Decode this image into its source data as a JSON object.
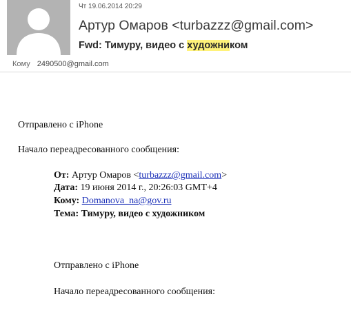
{
  "header": {
    "date": "Чт 19.06.2014 20:29",
    "from": "Артур Омаров <turbazzz@gmail.com>",
    "subject_parts": [
      "Fwd: Тимуру, видео с ",
      "художни",
      "ком"
    ],
    "to_label": "Кому",
    "to_value": "2490500@gmail.com"
  },
  "body": {
    "sent_from": "Отправлено с iPhone",
    "forward_start": "Начало переадресованного сообщения:",
    "fwd": {
      "from_label": "От:",
      "from_name": "Артур Омаров <",
      "from_email": "turbazzz@gmail.com",
      "from_close": ">",
      "date_label": "Дата:",
      "date_value": "19 июня 2014 г., 20:26:03 GMT+4",
      "to_label": "Кому:",
      "to_email": "Domanova_na@gov.ru",
      "subject_label": "Тема:",
      "subject_value": "Тимуру, видео с художником"
    },
    "nested_sent_from": "Отправлено с iPhone",
    "nested_forward_start": "Начало переадресованного сообщения:"
  }
}
